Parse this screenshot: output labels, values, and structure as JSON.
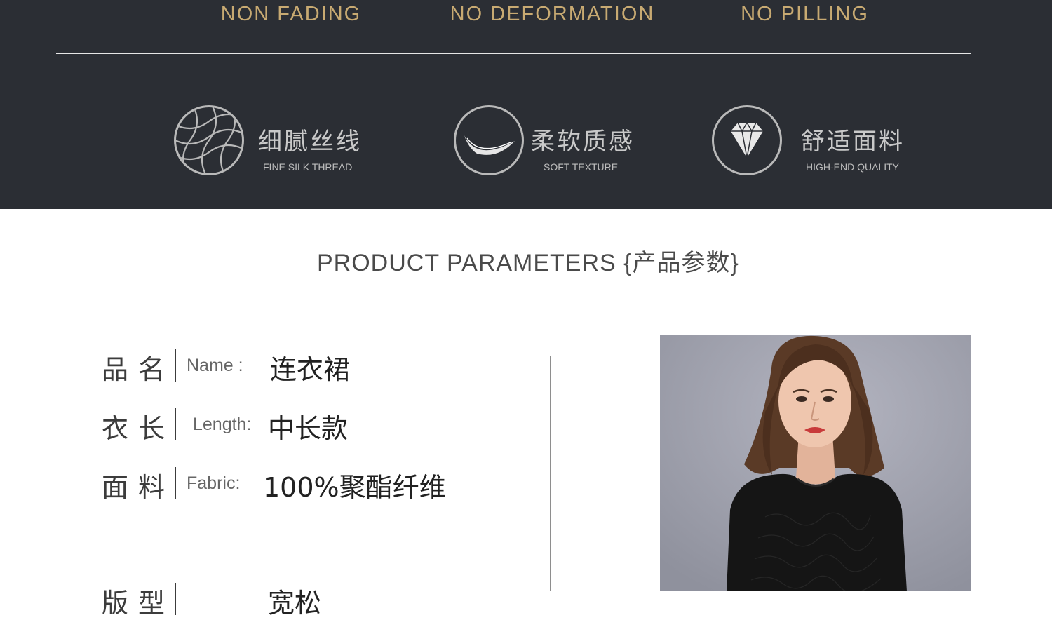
{
  "banner": {
    "top_features": [
      "NON FADING",
      "NO DEFORMATION",
      "NO PILLING"
    ],
    "badges": [
      {
        "icon": "mesh-thread-icon",
        "title": "细腻丝线",
        "subtitle": "FINE SILK THREAD"
      },
      {
        "icon": "soft-feather-icon",
        "title": "柔软质感",
        "subtitle": "SOFT TEXTURE"
      },
      {
        "icon": "diamond-icon",
        "title": "舒适面料",
        "subtitle": "HIGH-END QUALITY"
      }
    ]
  },
  "section": {
    "title": "PRODUCT PARAMETERS {产品参数}"
  },
  "params": [
    {
      "label": "品名",
      "en": "Name :",
      "value": "连衣裙"
    },
    {
      "label": "衣长",
      "en": "Length:",
      "value": "中长款"
    },
    {
      "label": "面料",
      "en": "Fabric:",
      "value": "100%聚酯纤维"
    },
    {
      "label": "版型",
      "en": "",
      "value": "宽松"
    }
  ],
  "colors": {
    "banner_bg": "#2b2e34",
    "gold": "#c8aa72"
  }
}
